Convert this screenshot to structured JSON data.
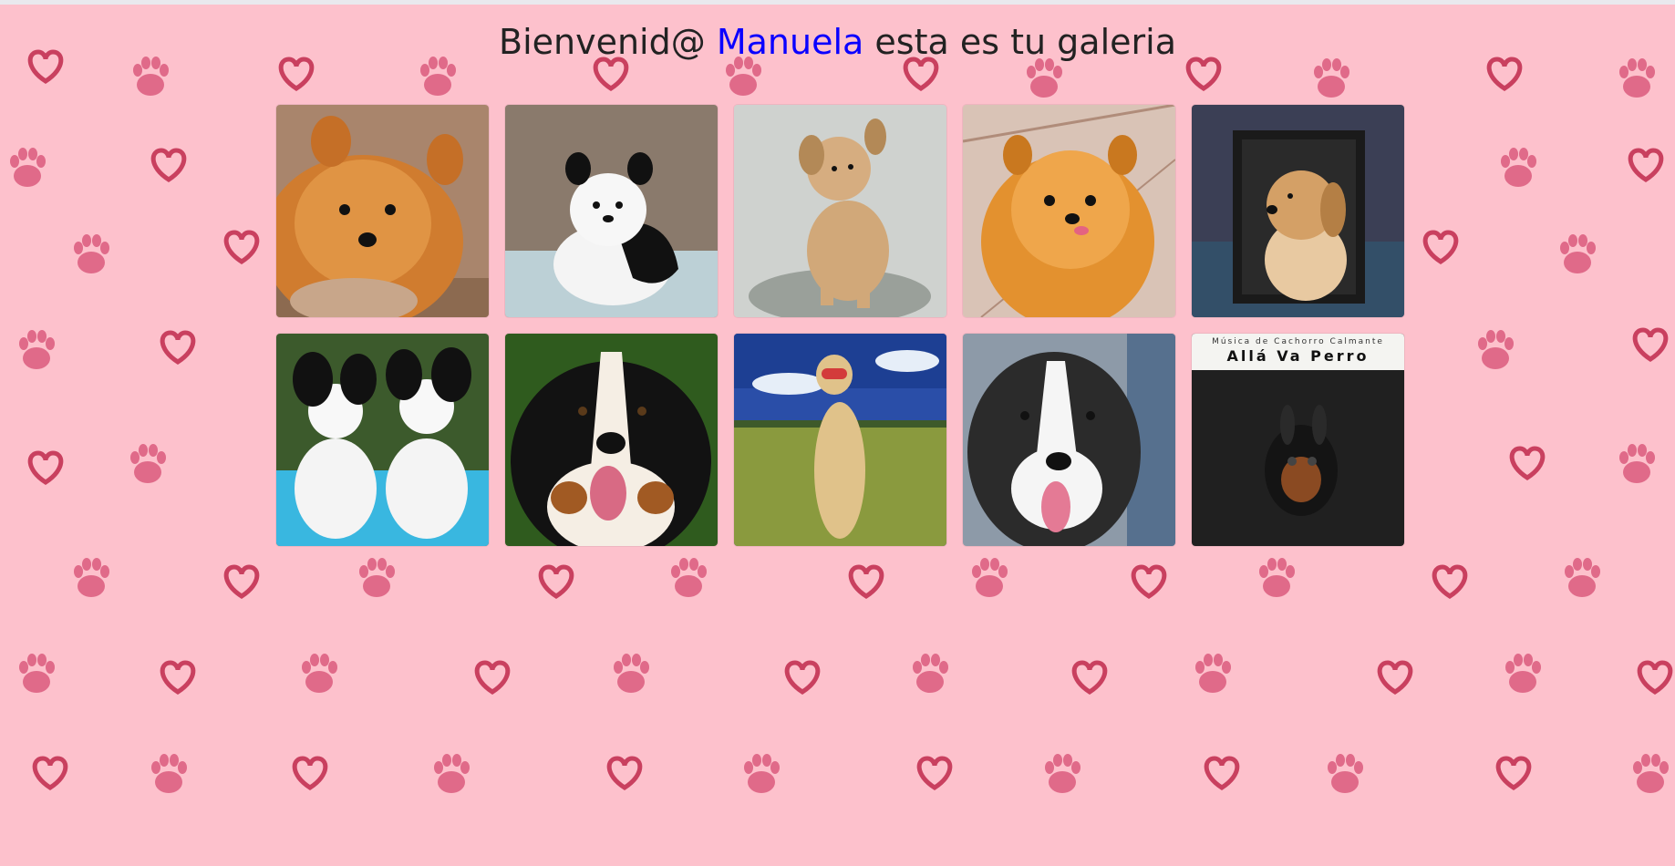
{
  "header": {
    "greeting": "Bienvenid@",
    "username": "Manuela",
    "suffix": "esta es tu galeria"
  },
  "colors": {
    "background": "#fdc1cc",
    "paw": "#e06a89",
    "heart": "#c9405f",
    "username": "#0a00ff"
  },
  "gallery": {
    "items": [
      {
        "name": "pomeranian-orange-lying",
        "icon": "dog-photo"
      },
      {
        "name": "black-white-puppy",
        "icon": "dog-photo"
      },
      {
        "name": "tan-puppy-sitting",
        "icon": "dog-photo"
      },
      {
        "name": "pomeranian-smiling",
        "icon": "dog-photo"
      },
      {
        "name": "golden-puppy-portrait",
        "icon": "dog-photo"
      },
      {
        "name": "two-papillons",
        "icon": "dog-photo"
      },
      {
        "name": "bernese-mountain-dog",
        "icon": "dog-photo"
      },
      {
        "name": "dog-standing-goggles",
        "icon": "dog-photo"
      },
      {
        "name": "border-collie-puppy",
        "icon": "dog-photo"
      },
      {
        "name": "album-cover-dachshund",
        "icon": "dog-photo"
      }
    ],
    "album": {
      "subtitle": "Música de Cachorro Calmante",
      "title": "Allá Va Perro"
    }
  }
}
